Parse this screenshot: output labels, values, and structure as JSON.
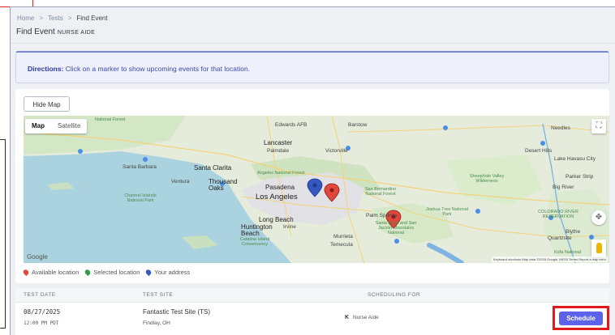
{
  "breadcrumb": {
    "items": [
      "Home",
      "Tests",
      "Find Event"
    ]
  },
  "page": {
    "title": "Find Event",
    "subtitle": "NURSE AIDE"
  },
  "directions": {
    "label": "Directions:",
    "text": "Click on a marker to show upcoming events for that location."
  },
  "map_section": {
    "hide_button": "Hide Map",
    "map_types": [
      "Map",
      "Satellite"
    ],
    "google": "Google",
    "attribution": "Keyboard shortcuts   Map data ©2025 Google, INEGI   Terms   Report a map error",
    "places": {
      "edwards": "Edwards AFB",
      "barstow": "Barstow",
      "needles": "Needles",
      "lancaster": "Lancaster",
      "palmdale": "Palmdale",
      "victorville": "Victorville",
      "santa_clarita": "Santa Clarita",
      "thousand_oaks": "Thousand Oaks",
      "pasadena": "Pasadena",
      "los_angeles": "Los Angeles",
      "san_bernardino": "San Bernardino National Forest",
      "long_beach": "Long Beach",
      "huntington": "Huntington Beach",
      "irvine": "Irvine",
      "palm_springs": "Palm Springs",
      "santa_rosa": "Santa Rosa and San Jacinto Mountains National",
      "joshua": "Joshua Tree National Park",
      "sheephole": "Sheephole Valley Wilderness",
      "colorado": "COLORADO RIVER RESERVATION",
      "blythe": "Blythe",
      "parker": "Parker Strip",
      "desert_hills": "Desert Hills",
      "lake_havasu": "Lake Havasu City",
      "santa_barbara": "Santa Barbara",
      "ventura": "Ventura",
      "catalina": "Catalina Island Conservancy",
      "murrieta": "Murrieta",
      "temecula": "Temecula",
      "angeles": "Angeles National Forest",
      "los_padres": "National Forest",
      "channel_islands": "Channel Islands National Park",
      "big_river": "Big River",
      "quartzsite": "Quartzsite",
      "kofa": "Kofa National"
    },
    "legend": [
      {
        "label": "Available location",
        "color": "#e0483b"
      },
      {
        "label": "Selected location",
        "color": "#2e9e4a"
      },
      {
        "label": "Your address",
        "color": "#3457c2"
      }
    ]
  },
  "table": {
    "headers": [
      "TEST DATE",
      "TEST SITE",
      "SCHEDULING FOR"
    ],
    "rows": [
      {
        "date": "08/27/2025",
        "time": "12:00 PM PDT",
        "site": "Fantastic Test Site (TS)",
        "location": "Findlay, OH",
        "badge": "K",
        "scheduling_for": "Nurse Aide",
        "action": "Schedule"
      }
    ]
  },
  "colors": {
    "accent": "#5d62ea",
    "highlight": "#e11a1a",
    "directions_text": "#3e4aa8"
  }
}
